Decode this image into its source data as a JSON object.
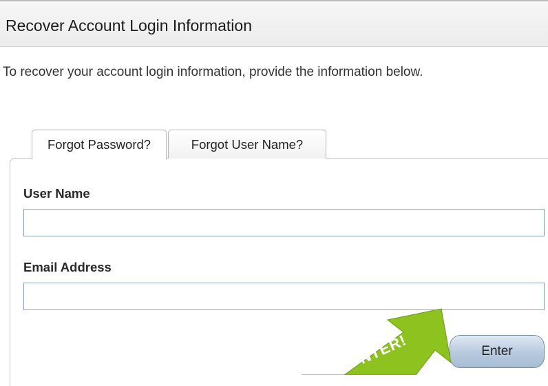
{
  "header": {
    "title": "Recover Account Login Information"
  },
  "intro": {
    "text": "To recover your account login information, provide the information below."
  },
  "tabs": [
    {
      "label": "Forgot Password?",
      "active": true
    },
    {
      "label": "Forgot User Name?",
      "active": false
    }
  ],
  "form": {
    "user_name_label": "User Name",
    "user_name_value": "",
    "email_label": "Email Address",
    "email_value": ""
  },
  "enter_button": {
    "label": "Enter"
  },
  "callout": {
    "text": "NTER!",
    "color": "#8dc21f"
  }
}
